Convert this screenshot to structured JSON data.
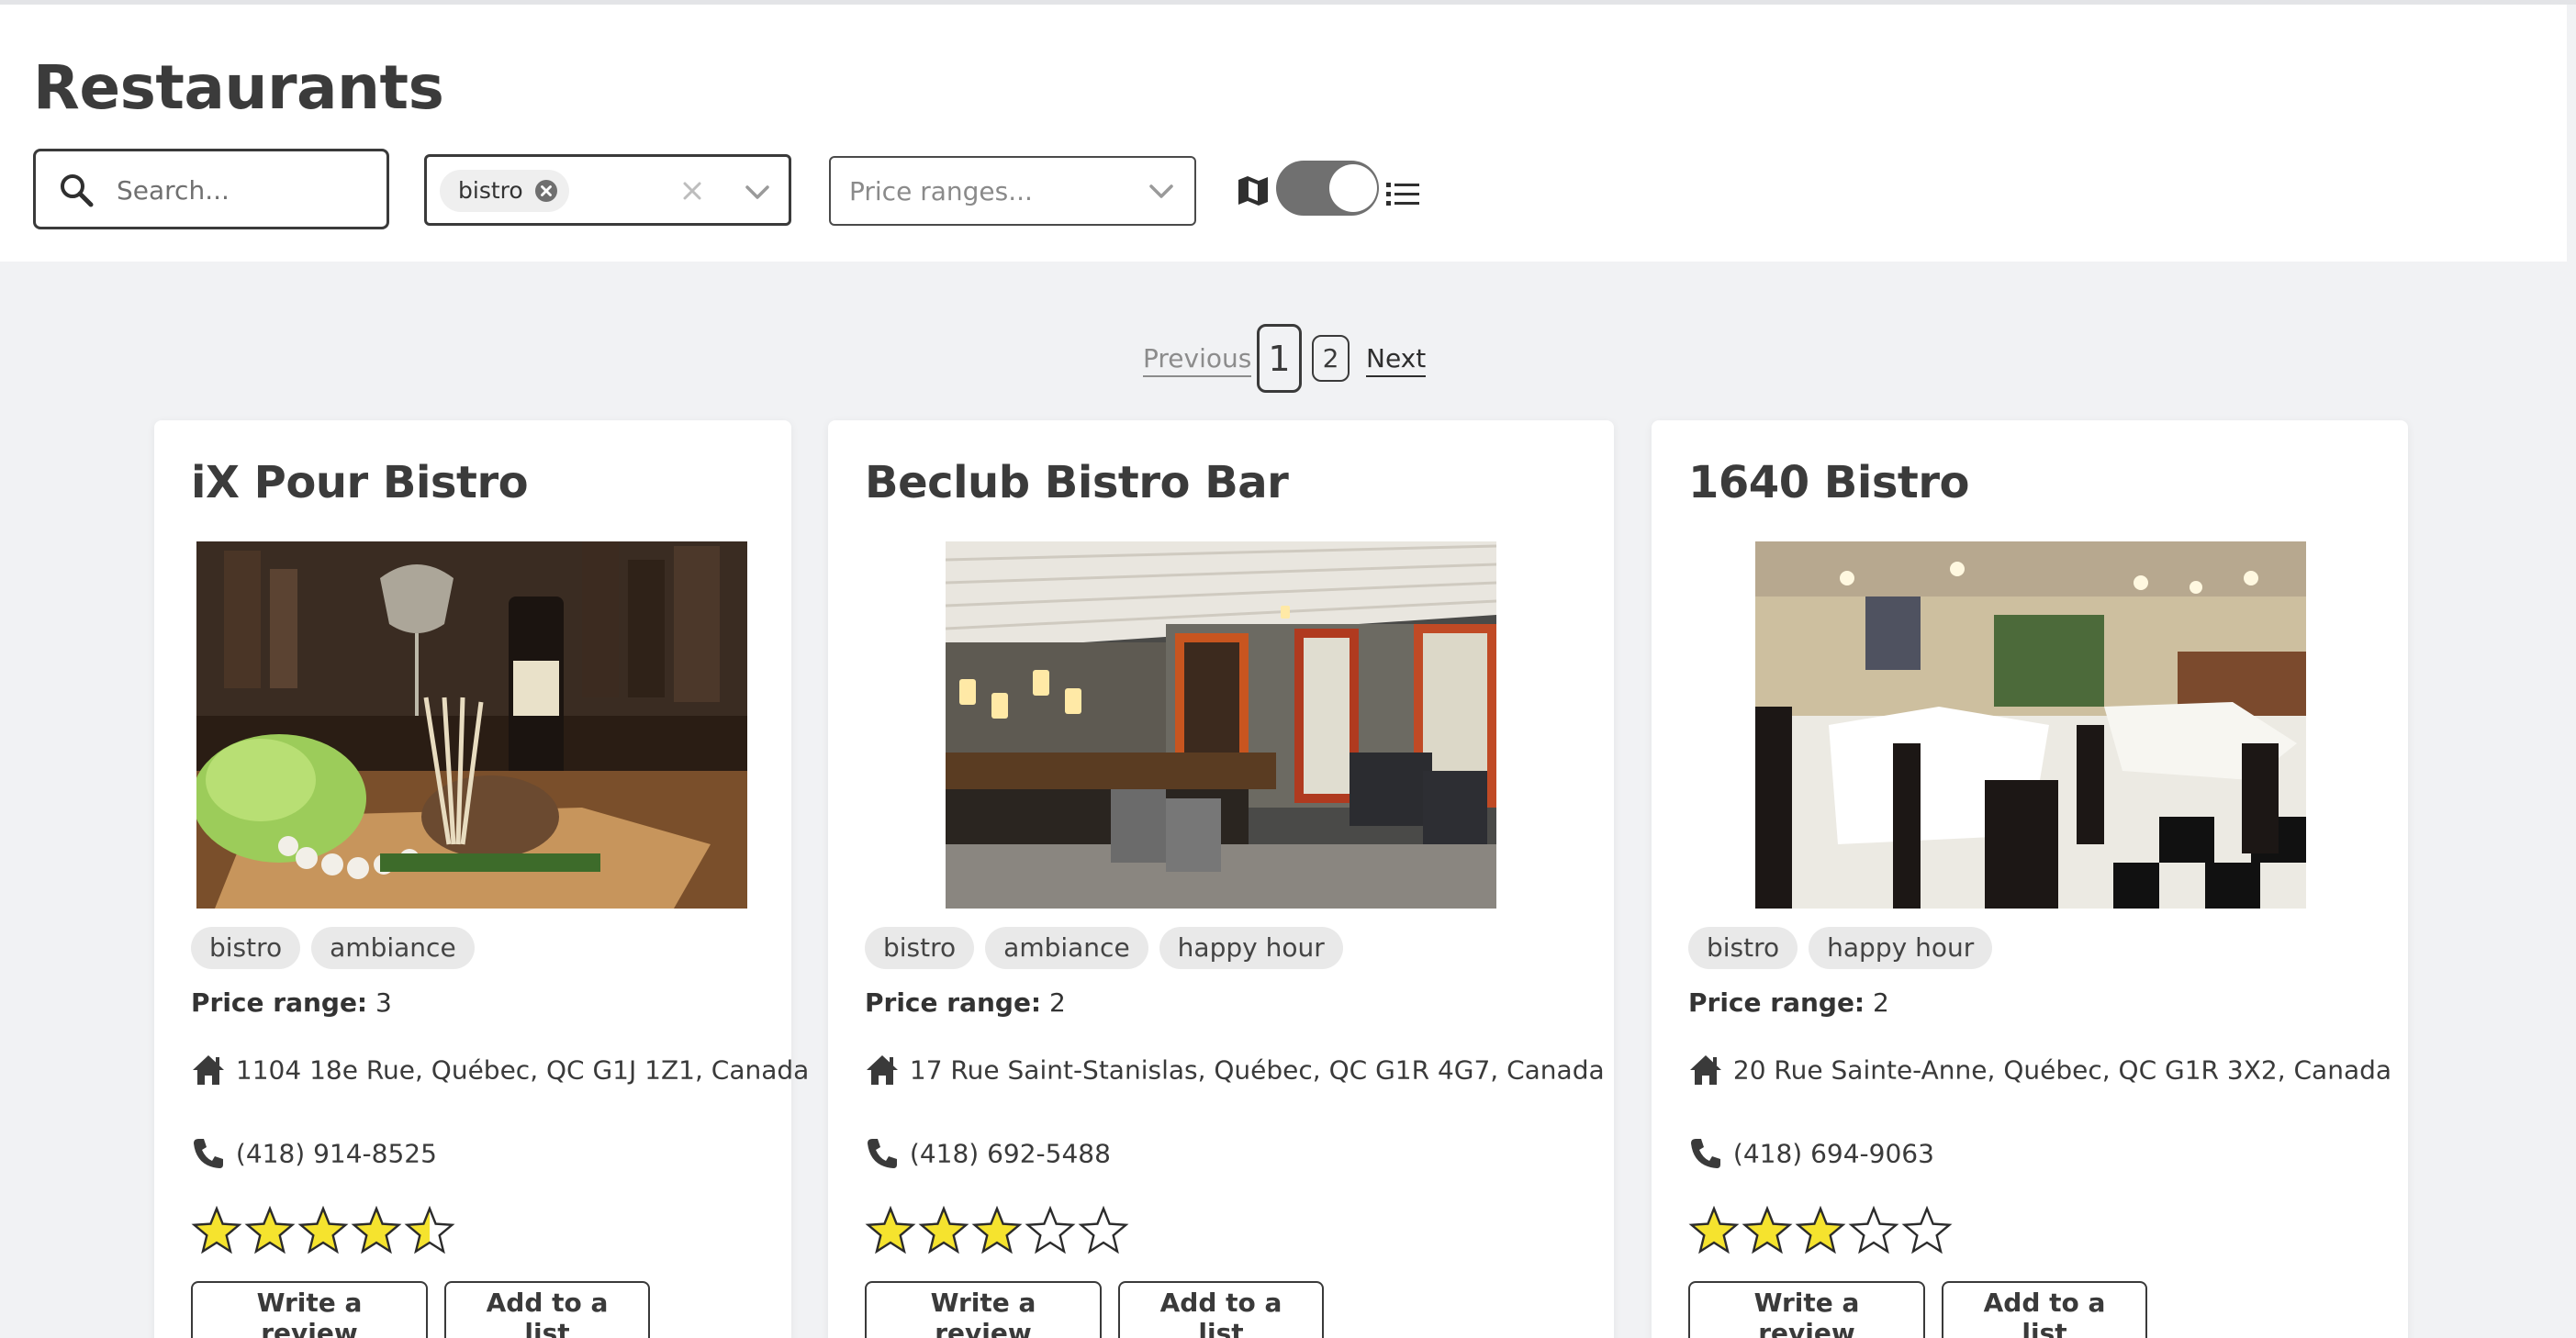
{
  "page": {
    "title": "Restaurants"
  },
  "filters": {
    "search_placeholder": "Search...",
    "selected_tag": "bistro",
    "price_placeholder": "Price ranges..."
  },
  "pagination": {
    "previous": "Previous",
    "pages": [
      "1",
      "2"
    ],
    "current": "1",
    "next": "Next"
  },
  "labels": {
    "price_range": "Price range:",
    "write_review": "Write a review",
    "add_to_list": "Add to a list"
  },
  "cards": [
    {
      "name": "iX Pour Bistro",
      "tags": [
        "bistro",
        "ambiance"
      ],
      "price": "3",
      "address": "1104 18e Rue, Québec, QC G1J 1Z1, Canada",
      "phone": "(418) 914-8525",
      "rating": 4.5
    },
    {
      "name": "Beclub Bistro Bar",
      "tags": [
        "bistro",
        "ambiance",
        "happy hour"
      ],
      "price": "2",
      "address": "17 Rue Saint-Stanislas, Québec, QC G1R 4G7, Canada",
      "phone": "(418) 692-5488",
      "rating": 3
    },
    {
      "name": "1640 Bistro",
      "tags": [
        "bistro",
        "happy hour"
      ],
      "price": "2",
      "address": "20 Rue Sainte-Anne, Québec, QC G1R 3X2, Canada",
      "phone": "(418) 694-9063",
      "rating": 3
    }
  ],
  "colors": {
    "star_fill": "#f5e32e",
    "star_stroke": "#2b2b2b",
    "page_bg": "#f1f2f4",
    "toggle": "#707070"
  }
}
